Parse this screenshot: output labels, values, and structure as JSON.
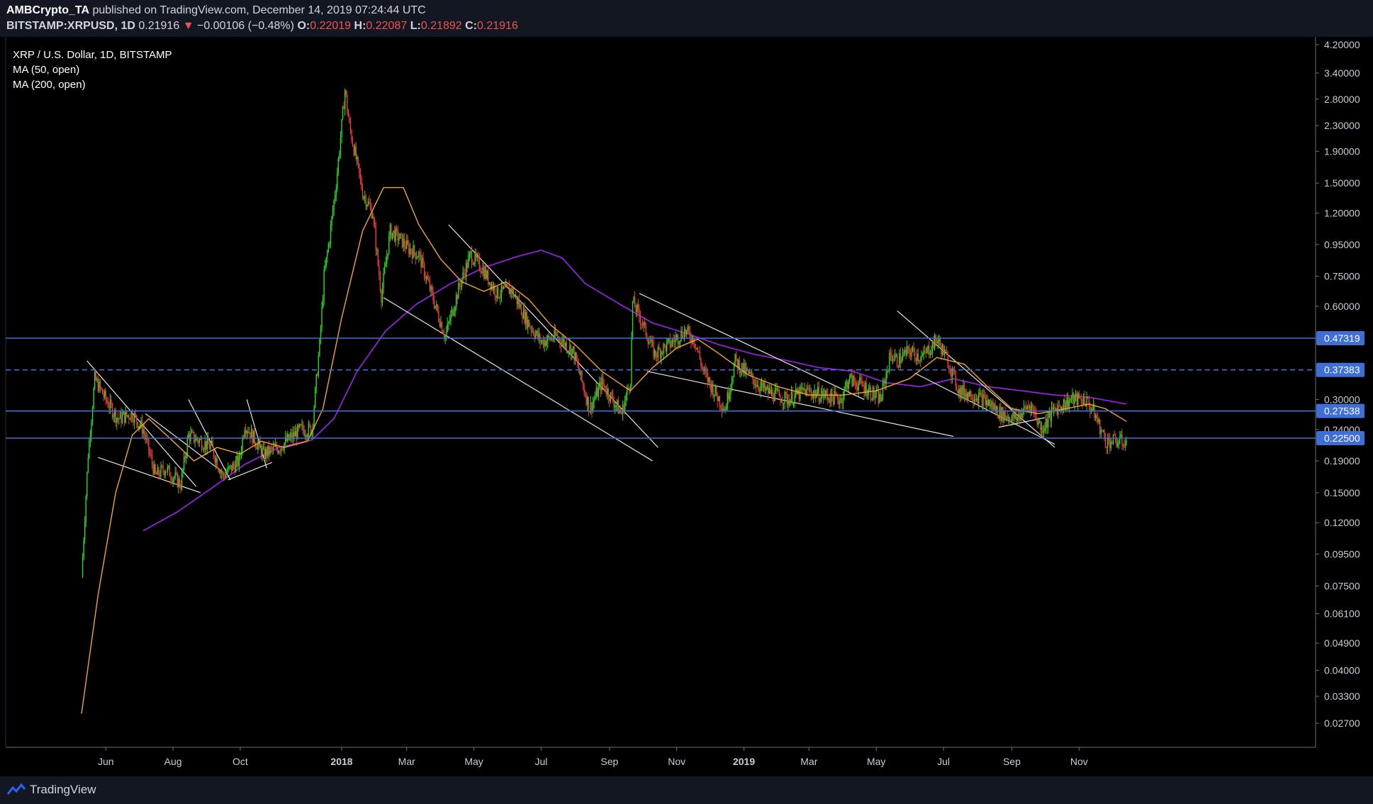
{
  "header": {
    "author": "AMBCrypto_TA",
    "published": "published on TradingView.com, December 14, 2019 07:24:44 UTC",
    "symbol": "BITSTAMP:XRPUSD, 1D",
    "last": "0.21916",
    "change": "−0.00106 (−0.48%)",
    "o_label": "O:",
    "o_value": "0.22019",
    "h_label": "H:",
    "h_value": "0.22087",
    "l_label": "L:",
    "l_value": "0.21892",
    "c_label": "C:",
    "c_value": "0.21916"
  },
  "legend": {
    "title": "XRP / U.S. Dollar, 1D, BITSTAMP",
    "ma50": "MA (50, open)",
    "ma200": "MA (200, open)"
  },
  "footer": {
    "brand": "TradingView"
  },
  "colors": {
    "background": "#000000",
    "panel": "#131722",
    "up": "#26d926",
    "down": "#ef3b3b",
    "ma50": "#f5a623",
    "ma200": "#a020f0",
    "level": "#3f6fd6",
    "trendline": "#e6e6e6",
    "axis_text": "#c8ccd6"
  },
  "chart_data": {
    "type": "candlestick",
    "scale": "log",
    "x_ticks": [
      "Jun",
      "Aug",
      "Oct",
      "2018",
      "Mar",
      "May",
      "Jul",
      "Sep",
      "Nov",
      "2019",
      "Mar",
      "May",
      "Jul",
      "Sep",
      "Nov"
    ],
    "y_ticks": [
      "4.20000",
      "3.40000",
      "2.80000",
      "2.30000",
      "1.90000",
      "1.50000",
      "1.20000",
      "0.95000",
      "0.75000",
      "0.60000",
      "0.47319",
      "0.37383",
      "0.30000",
      "0.27538",
      "0.24000",
      "0.22500",
      "0.19000",
      "0.15000",
      "0.12000",
      "0.09500",
      "0.07500",
      "0.06100",
      "0.04900",
      "0.04000",
      "0.03300",
      "0.02700"
    ],
    "levels": [
      {
        "value": "0.47319",
        "style": "solid"
      },
      {
        "value": "0.37383",
        "style": "dashed"
      },
      {
        "value": "0.27538",
        "style": "solid"
      },
      {
        "value": "0.22500",
        "style": "solid"
      }
    ],
    "price_path": [
      [
        "2017-05-10",
        0.08
      ],
      [
        "2017-05-16",
        0.2
      ],
      [
        "2017-05-22",
        0.35
      ],
      [
        "2017-06-01",
        0.3
      ],
      [
        "2017-06-12",
        0.26
      ],
      [
        "2017-06-25",
        0.27
      ],
      [
        "2017-07-05",
        0.24
      ],
      [
        "2017-07-16",
        0.17
      ],
      [
        "2017-07-25",
        0.18
      ],
      [
        "2017-08-08",
        0.16
      ],
      [
        "2017-08-15",
        0.23
      ],
      [
        "2017-08-26",
        0.22
      ],
      [
        "2017-09-05",
        0.21
      ],
      [
        "2017-09-15",
        0.17
      ],
      [
        "2017-09-30",
        0.19
      ],
      [
        "2017-10-05",
        0.25
      ],
      [
        "2017-10-15",
        0.22
      ],
      [
        "2017-10-22",
        0.2
      ],
      [
        "2017-11-05",
        0.21
      ],
      [
        "2017-11-25",
        0.24
      ],
      [
        "2017-12-05",
        0.24
      ],
      [
        "2017-12-12",
        0.45
      ],
      [
        "2017-12-16",
        0.75
      ],
      [
        "2017-12-21",
        1.0
      ],
      [
        "2017-12-27",
        1.5
      ],
      [
        "2018-01-01",
        2.3
      ],
      [
        "2018-01-04",
        3.0
      ],
      [
        "2018-01-08",
        2.3
      ],
      [
        "2018-01-14",
        1.8
      ],
      [
        "2018-01-20",
        1.4
      ],
      [
        "2018-01-29",
        1.2
      ],
      [
        "2018-02-06",
        0.65
      ],
      [
        "2018-02-14",
        1.05
      ],
      [
        "2018-02-22",
        1.0
      ],
      [
        "2018-03-03",
        0.92
      ],
      [
        "2018-03-12",
        0.88
      ],
      [
        "2018-03-24",
        0.65
      ],
      [
        "2018-04-05",
        0.48
      ],
      [
        "2018-04-18",
        0.7
      ],
      [
        "2018-04-28",
        0.88
      ],
      [
        "2018-05-08",
        0.8
      ],
      [
        "2018-05-22",
        0.66
      ],
      [
        "2018-06-04",
        0.68
      ],
      [
        "2018-06-18",
        0.54
      ],
      [
        "2018-07-01",
        0.46
      ],
      [
        "2018-07-15",
        0.48
      ],
      [
        "2018-07-30",
        0.43
      ],
      [
        "2018-08-14",
        0.28
      ],
      [
        "2018-08-25",
        0.34
      ],
      [
        "2018-09-12",
        0.27
      ],
      [
        "2018-09-20",
        0.35
      ],
      [
        "2018-09-22",
        0.62
      ],
      [
        "2018-09-29",
        0.55
      ],
      [
        "2018-10-12",
        0.42
      ],
      [
        "2018-10-28",
        0.46
      ],
      [
        "2018-11-08",
        0.5
      ],
      [
        "2018-11-17",
        0.47
      ],
      [
        "2018-11-25",
        0.37
      ],
      [
        "2018-12-07",
        0.31
      ],
      [
        "2018-12-15",
        0.28
      ],
      [
        "2018-12-24",
        0.4
      ],
      [
        "2019-01-05",
        0.36
      ],
      [
        "2019-01-20",
        0.32
      ],
      [
        "2019-02-10",
        0.3
      ],
      [
        "2019-02-25",
        0.32
      ],
      [
        "2019-03-15",
        0.31
      ],
      [
        "2019-03-30",
        0.3
      ],
      [
        "2019-04-06",
        0.35
      ],
      [
        "2019-04-20",
        0.33
      ],
      [
        "2019-05-05",
        0.3
      ],
      [
        "2019-05-14",
        0.42
      ],
      [
        "2019-05-20",
        0.4
      ],
      [
        "2019-05-31",
        0.43
      ],
      [
        "2019-06-12",
        0.41
      ],
      [
        "2019-06-25",
        0.47
      ],
      [
        "2019-07-05",
        0.4
      ],
      [
        "2019-07-15",
        0.32
      ],
      [
        "2019-07-30",
        0.31
      ],
      [
        "2019-08-12",
        0.29
      ],
      [
        "2019-08-22",
        0.27
      ],
      [
        "2019-09-05",
        0.26
      ],
      [
        "2019-09-18",
        0.29
      ],
      [
        "2019-09-28",
        0.24
      ],
      [
        "2019-10-10",
        0.28
      ],
      [
        "2019-10-25",
        0.3
      ],
      [
        "2019-11-07",
        0.3
      ],
      [
        "2019-11-15",
        0.27
      ],
      [
        "2019-11-25",
        0.22
      ],
      [
        "2019-12-05",
        0.22
      ],
      [
        "2019-12-14",
        0.219
      ]
    ],
    "ma50_path": [
      [
        "2017-05-10",
        0.029
      ],
      [
        "2017-05-25",
        0.07
      ],
      [
        "2017-06-10",
        0.15
      ],
      [
        "2017-06-25",
        0.23
      ],
      [
        "2017-07-10",
        0.26
      ],
      [
        "2017-08-01",
        0.22
      ],
      [
        "2017-08-20",
        0.19
      ],
      [
        "2017-09-10",
        0.21
      ],
      [
        "2017-10-01",
        0.2
      ],
      [
        "2017-10-20",
        0.22
      ],
      [
        "2017-11-10",
        0.21
      ],
      [
        "2017-12-01",
        0.22
      ],
      [
        "2017-12-15",
        0.28
      ],
      [
        "2018-01-01",
        0.55
      ],
      [
        "2018-01-20",
        1.05
      ],
      [
        "2018-02-08",
        1.45
      ],
      [
        "2018-02-26",
        1.45
      ],
      [
        "2018-03-12",
        1.1
      ],
      [
        "2018-04-01",
        0.85
      ],
      [
        "2018-04-20",
        0.72
      ],
      [
        "2018-05-10",
        0.67
      ],
      [
        "2018-05-30",
        0.72
      ],
      [
        "2018-06-20",
        0.63
      ],
      [
        "2018-07-10",
        0.52
      ],
      [
        "2018-08-01",
        0.45
      ],
      [
        "2018-08-25",
        0.37
      ],
      [
        "2018-09-20",
        0.32
      ],
      [
        "2018-10-10",
        0.38
      ],
      [
        "2018-11-01",
        0.44
      ],
      [
        "2018-11-20",
        0.47
      ],
      [
        "2018-12-10",
        0.42
      ],
      [
        "2019-01-05",
        0.36
      ],
      [
        "2019-02-01",
        0.33
      ],
      [
        "2019-03-01",
        0.31
      ],
      [
        "2019-04-01",
        0.31
      ],
      [
        "2019-05-01",
        0.32
      ],
      [
        "2019-05-31",
        0.35
      ],
      [
        "2019-06-25",
        0.41
      ],
      [
        "2019-07-20",
        0.39
      ],
      [
        "2019-08-10",
        0.33
      ],
      [
        "2019-09-01",
        0.28
      ],
      [
        "2019-09-25",
        0.27
      ],
      [
        "2019-10-20",
        0.28
      ],
      [
        "2019-11-10",
        0.29
      ],
      [
        "2019-11-25",
        0.28
      ],
      [
        "2019-12-14",
        0.255
      ]
    ],
    "ma200_path": [
      [
        "2017-07-05",
        0.113
      ],
      [
        "2017-08-05",
        0.13
      ],
      [
        "2017-09-05",
        0.155
      ],
      [
        "2017-10-05",
        0.185
      ],
      [
        "2017-11-05",
        0.21
      ],
      [
        "2017-12-05",
        0.222
      ],
      [
        "2017-12-25",
        0.26
      ],
      [
        "2018-01-15",
        0.37
      ],
      [
        "2018-02-10",
        0.5
      ],
      [
        "2018-03-10",
        0.61
      ],
      [
        "2018-04-10",
        0.71
      ],
      [
        "2018-05-10",
        0.8
      ],
      [
        "2018-06-10",
        0.87
      ],
      [
        "2018-07-01",
        0.91
      ],
      [
        "2018-07-20",
        0.86
      ],
      [
        "2018-08-10",
        0.71
      ],
      [
        "2018-09-10",
        0.61
      ],
      [
        "2018-10-10",
        0.53
      ],
      [
        "2018-11-10",
        0.49
      ],
      [
        "2018-12-10",
        0.45
      ],
      [
        "2019-01-10",
        0.42
      ],
      [
        "2019-02-10",
        0.4
      ],
      [
        "2019-03-10",
        0.38
      ],
      [
        "2019-04-10",
        0.37
      ],
      [
        "2019-05-10",
        0.34
      ],
      [
        "2019-06-10",
        0.33
      ],
      [
        "2019-07-10",
        0.35
      ],
      [
        "2019-08-10",
        0.33
      ],
      [
        "2019-09-10",
        0.32
      ],
      [
        "2019-10-10",
        0.31
      ],
      [
        "2019-11-10",
        0.305
      ],
      [
        "2019-12-14",
        0.29
      ]
    ],
    "trendlines": [
      [
        [
          "2017-05-15",
          0.4
        ],
        [
          "2017-08-22",
          0.157
        ]
      ],
      [
        [
          "2017-05-25",
          0.195
        ],
        [
          "2017-08-26",
          0.15
        ]
      ],
      [
        [
          "2017-08-15",
          0.3
        ],
        [
          "2017-09-22",
          0.165
        ]
      ],
      [
        [
          "2017-10-07",
          0.3
        ],
        [
          "2017-10-25",
          0.18
        ]
      ],
      [
        [
          "2017-07-07",
          0.27
        ],
        [
          "2017-09-15",
          0.175
        ]
      ],
      [
        [
          "2017-09-20",
          0.165
        ],
        [
          "2017-10-30",
          0.188
        ]
      ],
      [
        [
          "2018-04-08",
          1.1
        ],
        [
          "2018-10-15",
          0.21
        ]
      ],
      [
        [
          "2018-02-08",
          0.64
        ],
        [
          "2018-10-10",
          0.19
        ]
      ],
      [
        [
          "2018-09-28",
          0.66
        ],
        [
          "2019-04-20",
          0.3
        ]
      ],
      [
        [
          "2018-10-05",
          0.37
        ],
        [
          "2019-07-10",
          0.228
        ]
      ],
      [
        [
          "2019-05-20",
          0.58
        ],
        [
          "2019-10-10",
          0.21
        ]
      ],
      [
        [
          "2019-06-05",
          0.365
        ],
        [
          "2019-10-10",
          0.215
        ]
      ],
      [
        [
          "2019-08-20",
          0.244
        ],
        [
          "2019-10-01",
          0.262
        ]
      ]
    ]
  }
}
